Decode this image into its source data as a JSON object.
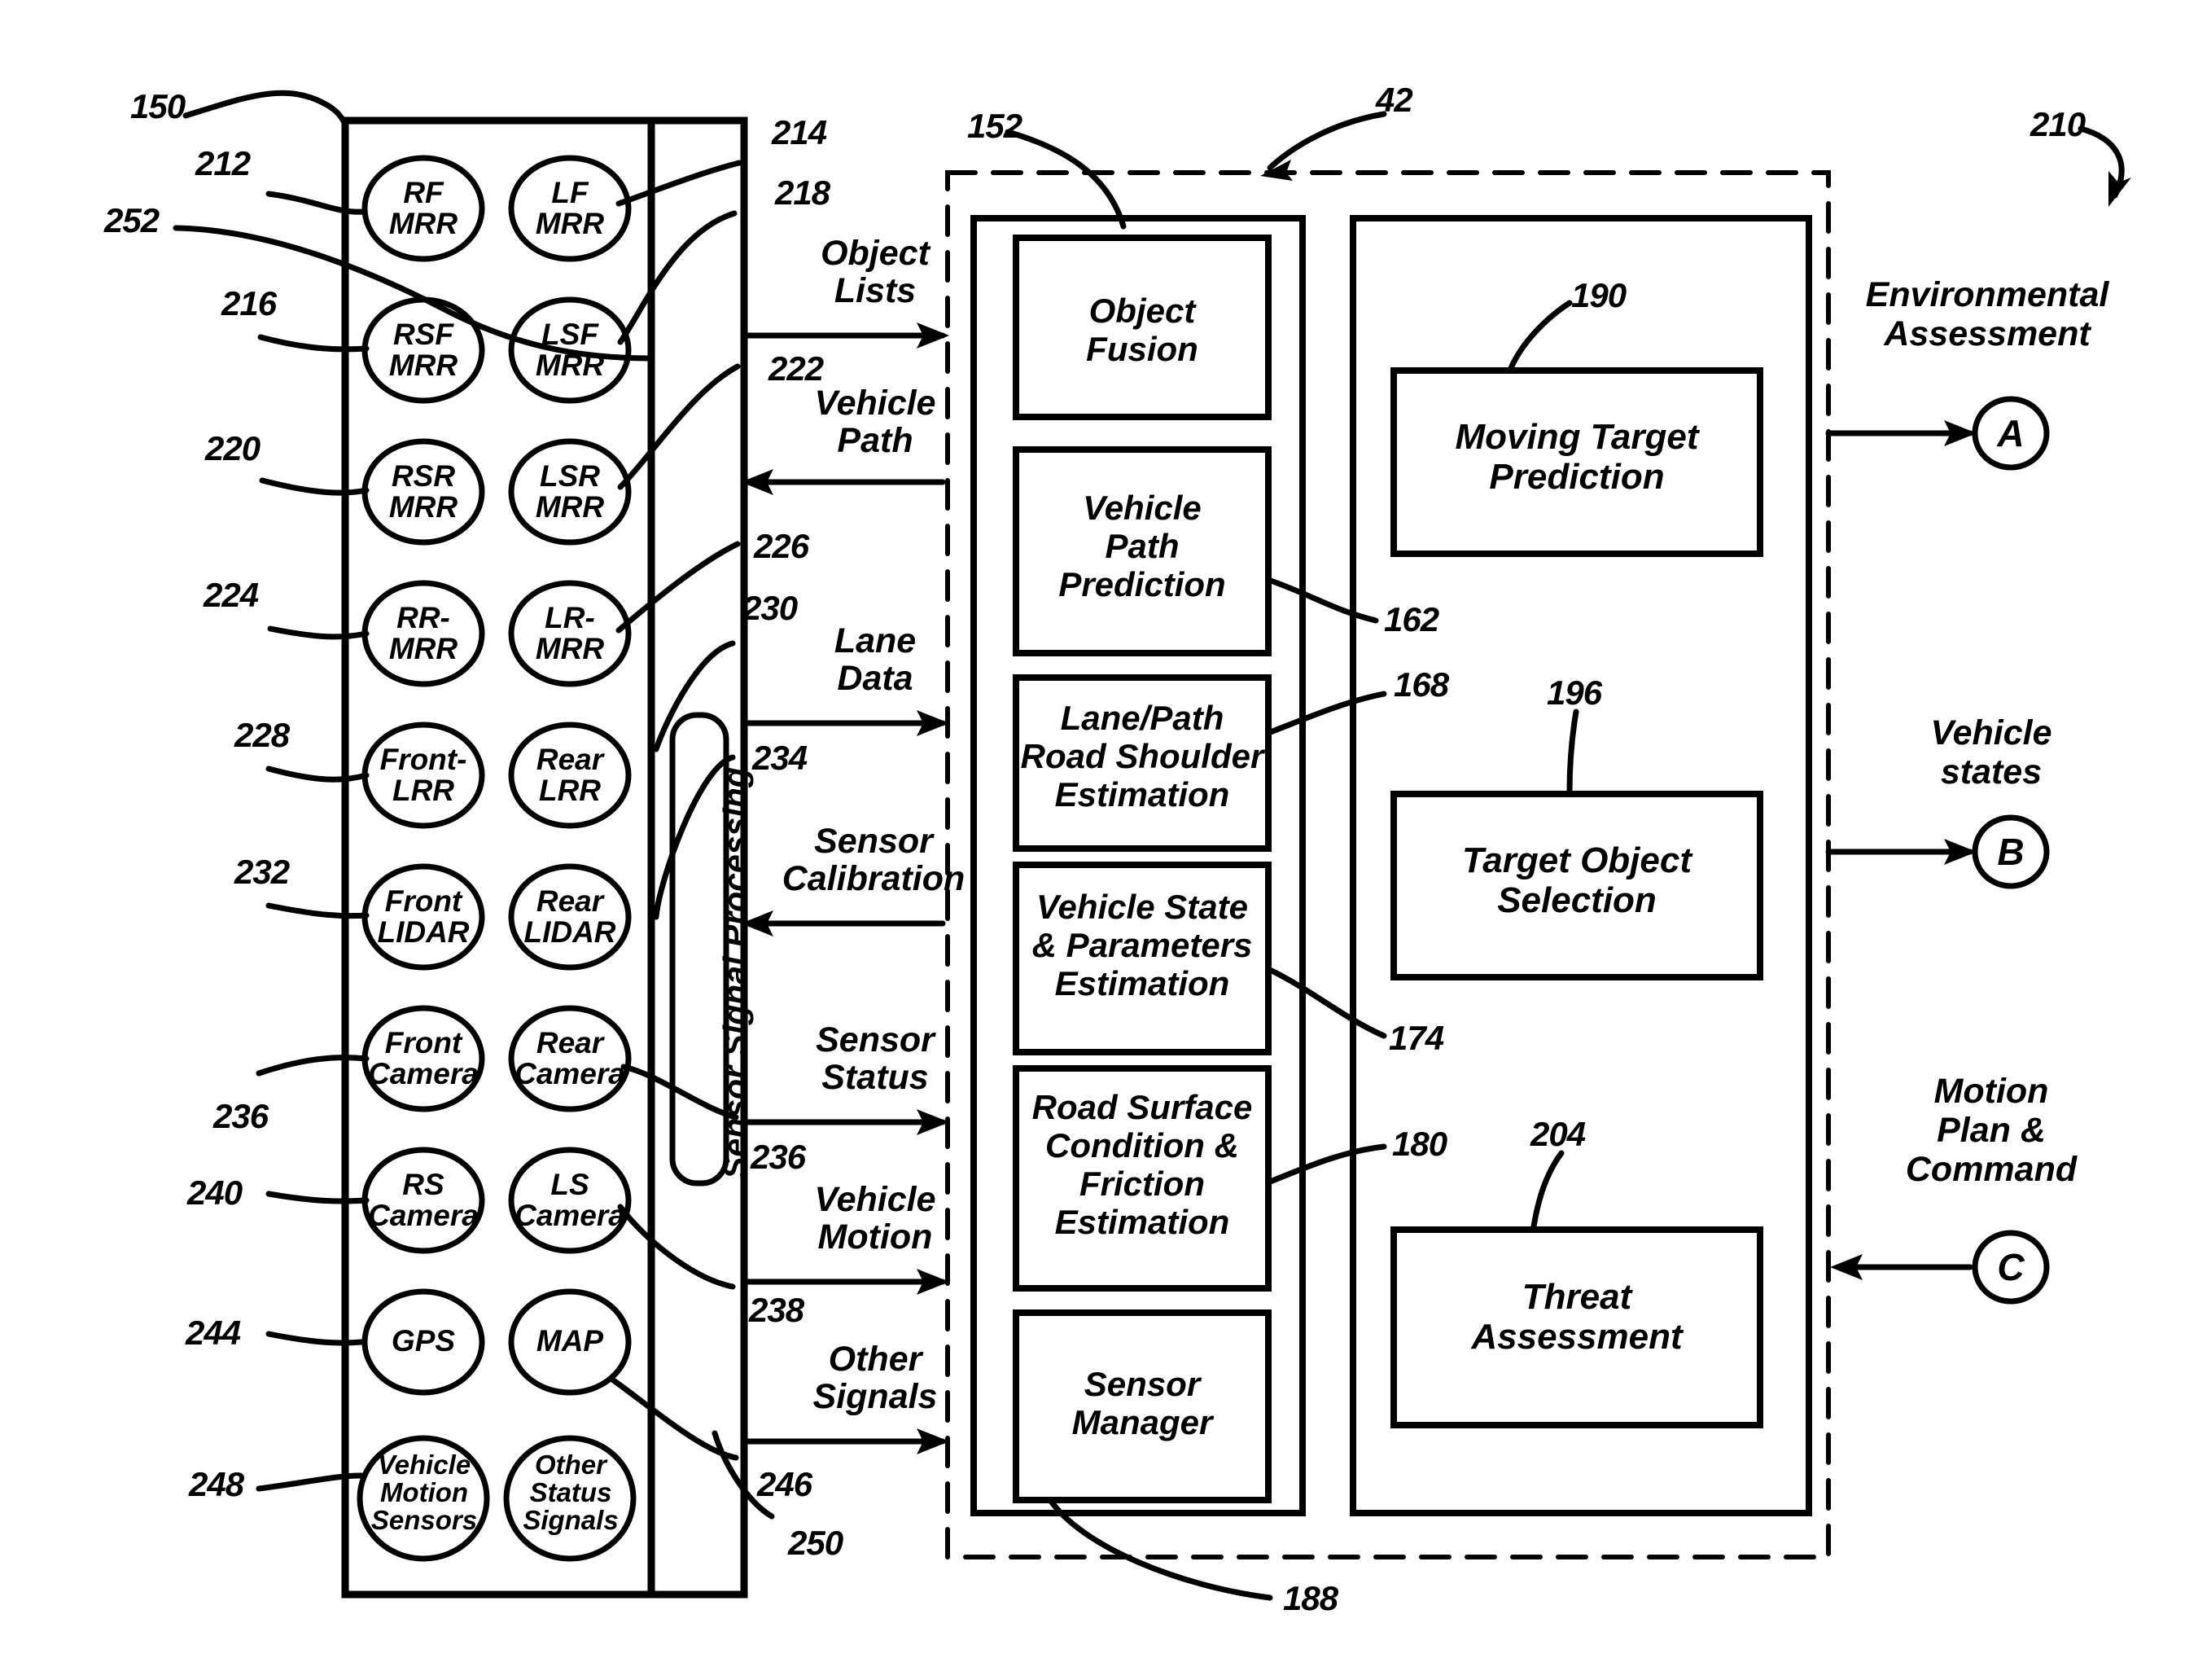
{
  "figure": {
    "main_ref": "210",
    "sensor_block_ref": "150",
    "sensor_bus_ref": "252",
    "sensor_signal_processing_label": "Sensor Signal Processing",
    "sensor_signal_processing_ref": "250",
    "processing_module_ref": "152",
    "system_boundary_ref": "42",
    "sensor_manager_leader_ref": "188"
  },
  "sensors": {
    "left_column": [
      {
        "label": "RF\nMRR",
        "ref": "212"
      },
      {
        "label": "RSF\nMRR",
        "ref": "216"
      },
      {
        "label": "RSR\nMRR",
        "ref": "220"
      },
      {
        "label": "RR-\nMRR",
        "ref": "224"
      },
      {
        "label": "Front-\nLRR",
        "ref": "228"
      },
      {
        "label": "Front\nLIDAR",
        "ref": "232"
      },
      {
        "label": "Front\nCamera",
        "ref": "236"
      },
      {
        "label": "RS\nCamera",
        "ref": "240"
      },
      {
        "label": "GPS",
        "ref": "244"
      },
      {
        "label": "Vehicle\nMotion\nSensors",
        "ref": "248"
      }
    ],
    "right_column": [
      {
        "label": "LF\nMRR",
        "ref": "214"
      },
      {
        "label": "LSF\nMRR",
        "ref": "218"
      },
      {
        "label": "LSR\nMRR",
        "ref": "222"
      },
      {
        "label": "LR-\nMRR",
        "ref": "226"
      },
      {
        "label": "Rear\nLRR",
        "ref": "230"
      },
      {
        "label": "Rear\nLIDAR",
        "ref": "234"
      },
      {
        "label": "Rear\nCamera",
        "ref": "236"
      },
      {
        "label": "LS\nCamera",
        "ref": "238"
      },
      {
        "label": "MAP",
        "ref": ""
      },
      {
        "label": "Other\nStatus\nSignals",
        "ref": "246"
      }
    ]
  },
  "signals": [
    {
      "label": "Object\nLists",
      "direction": "right",
      "ref": ""
    },
    {
      "label": "Vehicle\nPath",
      "direction": "left",
      "ref": ""
    },
    {
      "label": "Lane\nData",
      "direction": "right",
      "ref": ""
    },
    {
      "label": "Sensor\nCalibration",
      "direction": "left",
      "ref": ""
    },
    {
      "label": "Sensor\nStatus",
      "direction": "right",
      "ref": ""
    },
    {
      "label": "Vehicle\nMotion",
      "direction": "right",
      "ref": ""
    },
    {
      "label": "Other\nSignals",
      "direction": "right",
      "ref": ""
    }
  ],
  "processing_modules": [
    {
      "label": "Object\nFusion",
      "ref": ""
    },
    {
      "label": "Vehicle\nPath\nPrediction",
      "ref": "162"
    },
    {
      "label": "Lane/Path\nRoad Shoulder\nEstimation",
      "ref": "168"
    },
    {
      "label": "Vehicle State\n& Parameters\nEstimation",
      "ref": "174"
    },
    {
      "label": "Road Surface\nCondition &\nFriction\nEstimation",
      "ref": "180"
    },
    {
      "label": "Sensor\nManager",
      "ref": ""
    }
  ],
  "assessment_modules": [
    {
      "label": "Moving Target\nPrediction",
      "ref": "190"
    },
    {
      "label": "Target Object\nSelection",
      "ref": "196"
    },
    {
      "label": "Threat\nAssessment",
      "ref": "204"
    }
  ],
  "outputs": [
    {
      "label": "Environmental\nAssessment",
      "node": "A",
      "direction": "right"
    },
    {
      "label": "Vehicle\nstates",
      "node": "B",
      "direction": "right"
    },
    {
      "label": "Motion\nPlan &\nCommand",
      "node": "C",
      "direction": "left"
    }
  ]
}
